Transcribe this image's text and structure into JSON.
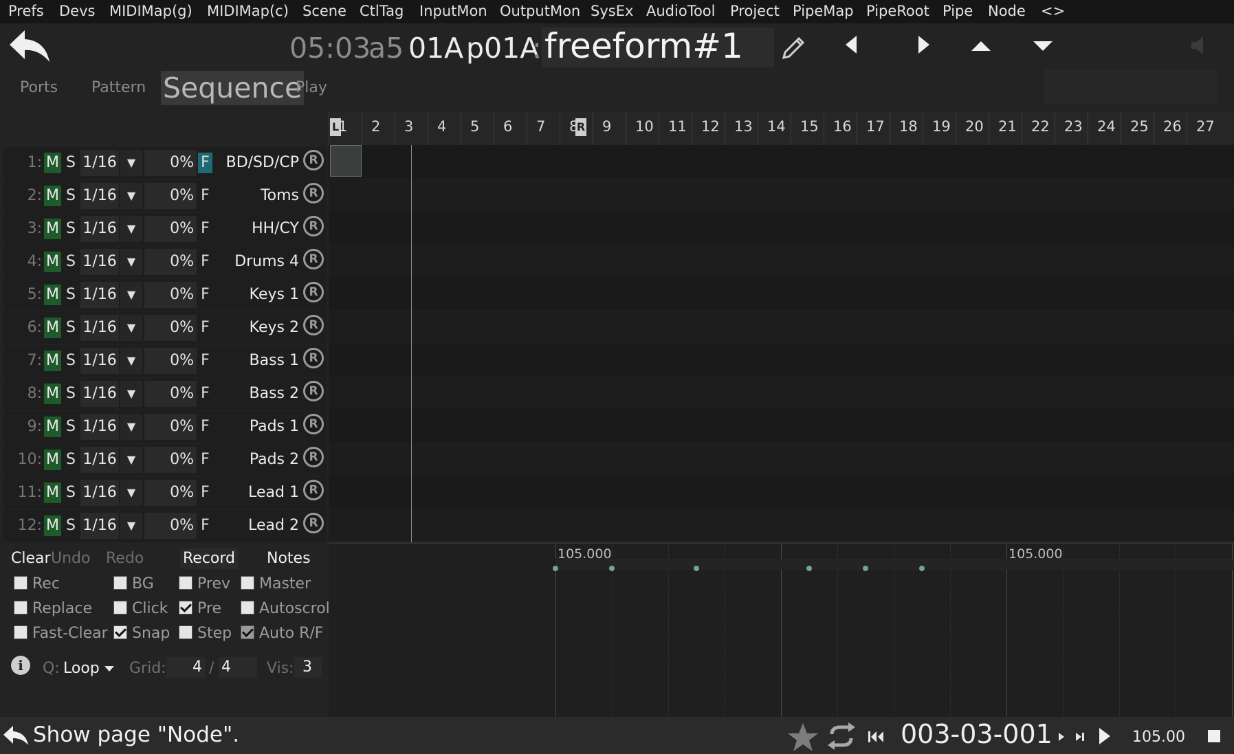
{
  "menu": [
    "Prefs",
    "Devs",
    "MIDIMap(g)",
    "MIDIMap(c)",
    "Scene",
    "CtlTag",
    "InputMon",
    "OutputMon",
    "SysEx",
    "AudioTool",
    "Project",
    "PipeMap",
    "PipeRoot",
    "Pipe",
    "Node",
    "<>"
  ],
  "header": {
    "time": "05:03",
    "bank": "a5",
    "pattern_id": "01A",
    "pattern_p": "p01A",
    "sep": ":",
    "name": "freeform#1"
  },
  "tabs": {
    "ports": "Ports",
    "pattern": "Pattern",
    "sequence": "Sequence",
    "play": "Play"
  },
  "ruler": {
    "bars": [
      "1",
      "2",
      "3",
      "4",
      "5",
      "6",
      "7",
      "8",
      "9",
      "10",
      "11",
      "12",
      "13",
      "14",
      "15",
      "16",
      "17",
      "18",
      "19",
      "20",
      "21",
      "22",
      "23",
      "24",
      "25",
      "26",
      "27"
    ],
    "loop_start_marker": "L",
    "loop_end_marker": "R"
  },
  "tracks": [
    {
      "num": "1:",
      "mute": "M",
      "solo": "S",
      "quant": "1/16",
      "pct": "0%",
      "flag": "F",
      "flag_active": true,
      "name": "BD/SD/CP",
      "rec": "R"
    },
    {
      "num": "2:",
      "mute": "M",
      "solo": "S",
      "quant": "1/16",
      "pct": "0%",
      "flag": "F",
      "flag_active": false,
      "name": "Toms",
      "rec": "R"
    },
    {
      "num": "3:",
      "mute": "M",
      "solo": "S",
      "quant": "1/16",
      "pct": "0%",
      "flag": "F",
      "flag_active": false,
      "name": "HH/CY",
      "rec": "R"
    },
    {
      "num": "4:",
      "mute": "M",
      "solo": "S",
      "quant": "1/16",
      "pct": "0%",
      "flag": "F",
      "flag_active": false,
      "name": "Drums 4",
      "rec": "R"
    },
    {
      "num": "5:",
      "mute": "M",
      "solo": "S",
      "quant": "1/16",
      "pct": "0%",
      "flag": "F",
      "flag_active": false,
      "name": "Keys 1",
      "rec": "R"
    },
    {
      "num": "6:",
      "mute": "M",
      "solo": "S",
      "quant": "1/16",
      "pct": "0%",
      "flag": "F",
      "flag_active": false,
      "name": "Keys 2",
      "rec": "R"
    },
    {
      "num": "7:",
      "mute": "M",
      "solo": "S",
      "quant": "1/16",
      "pct": "0%",
      "flag": "F",
      "flag_active": false,
      "name": "Bass 1",
      "rec": "R"
    },
    {
      "num": "8:",
      "mute": "M",
      "solo": "S",
      "quant": "1/16",
      "pct": "0%",
      "flag": "F",
      "flag_active": false,
      "name": "Bass 2",
      "rec": "R"
    },
    {
      "num": "9:",
      "mute": "M",
      "solo": "S",
      "quant": "1/16",
      "pct": "0%",
      "flag": "F",
      "flag_active": false,
      "name": "Pads 1",
      "rec": "R"
    },
    {
      "num": "10:",
      "mute": "M",
      "solo": "S",
      "quant": "1/16",
      "pct": "0%",
      "flag": "F",
      "flag_active": false,
      "name": "Pads 2",
      "rec": "R"
    },
    {
      "num": "11:",
      "mute": "M",
      "solo": "S",
      "quant": "1/16",
      "pct": "0%",
      "flag": "F",
      "flag_active": false,
      "name": "Lead 1",
      "rec": "R"
    },
    {
      "num": "12:",
      "mute": "M",
      "solo": "S",
      "quant": "1/16",
      "pct": "0%",
      "flag": "F",
      "flag_active": false,
      "name": "Lead 2",
      "rec": "R"
    }
  ],
  "edit": {
    "clear": "Clear",
    "undo": "Undo",
    "redo": "Redo",
    "record": "Record",
    "notes": "Notes"
  },
  "options": [
    {
      "label": "Rec",
      "checked": false,
      "dim": false
    },
    {
      "label": "BG",
      "checked": false,
      "dim": false
    },
    {
      "label": "Prev",
      "checked": false,
      "dim": false
    },
    {
      "label": "Master",
      "checked": false,
      "dim": false
    },
    {
      "label": "Replace",
      "checked": false,
      "dim": false
    },
    {
      "label": "Click",
      "checked": false,
      "dim": false
    },
    {
      "label": "Pre",
      "checked": true,
      "dim": false
    },
    {
      "label": "Autoscroll",
      "checked": false,
      "dim": false
    },
    {
      "label": "Fast-Clear",
      "checked": false,
      "dim": false
    },
    {
      "label": "Snap",
      "checked": true,
      "dim": false
    },
    {
      "label": "Step",
      "checked": false,
      "dim": false
    },
    {
      "label": "Auto R/F",
      "checked": true,
      "dim": true
    }
  ],
  "footer_controls": {
    "info_icon": "i",
    "q_label": "Q:",
    "q_value": "Loop",
    "grid_label": "Grid:",
    "grid_num": "4",
    "grid_sep": "/",
    "grid_den": "4",
    "vis_label": "Vis:",
    "vis_value": "3"
  },
  "automation": {
    "markers": [
      "105.000",
      "105.000"
    ]
  },
  "status": {
    "message": "Show page \"Node\".",
    "position": "003-03-001",
    "tempo": "105.00"
  },
  "icons": {
    "back": "back-arrow-icon",
    "pencil": "pencil-icon",
    "prev": "triangle-left-icon",
    "next": "triangle-right-icon",
    "up": "triangle-up-icon",
    "down": "triangle-down-icon",
    "speaker": "speaker-icon",
    "star": "star-icon",
    "loop": "loop-icon",
    "rewind": "rewind-icon",
    "step_fwd": "step-forward-icon",
    "skip_end": "skip-end-icon",
    "play": "play-icon",
    "stop": "stop-icon"
  },
  "colors": {
    "mute_active": "#1f5a2a",
    "flag_active": "#1e6a74",
    "automation_dot": "#6ea69a"
  }
}
